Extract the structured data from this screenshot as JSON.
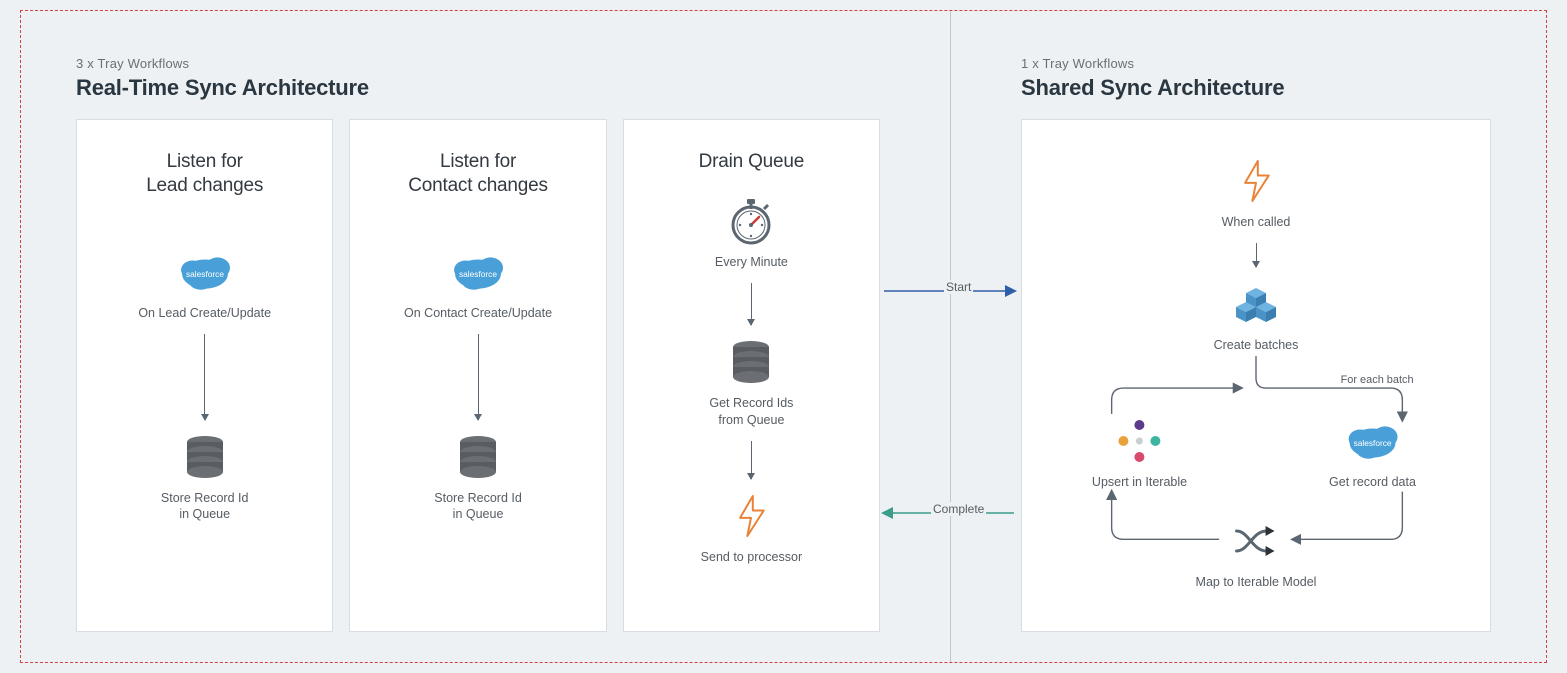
{
  "left": {
    "subtitle": "3 x Tray Workflows",
    "title": "Real-Time Sync Architecture",
    "cards": [
      {
        "title": "Listen for\nLead changes",
        "top_label": "On Lead Create/Update",
        "bottom_label": "Store Record Id\nin Queue"
      },
      {
        "title": "Listen for\nContact changes",
        "top_label": "On Contact Create/Update",
        "bottom_label": "Store Record Id\nin Queue"
      },
      {
        "title": "Drain Queue",
        "every": "Every Minute",
        "mid": "Get Record Ids\nfrom Queue",
        "bottom": "Send to processor"
      }
    ]
  },
  "right": {
    "subtitle": "1 x Tray Workflows",
    "title": "Shared Sync Architecture",
    "card": {
      "when_called": "When called",
      "create_batches": "Create batches",
      "for_each": "For each batch",
      "get_record": "Get record data",
      "map_model": "Map to Iterable Model",
      "upsert": "Upsert in Iterable"
    }
  },
  "connectors": {
    "start": "Start",
    "complete": "Complete"
  },
  "icons": {
    "salesforce": "salesforce",
    "database": "database",
    "stopwatch": "stopwatch",
    "bolt": "bolt",
    "cubes": "cubes",
    "shuffle": "shuffle",
    "iterable": "iterable"
  }
}
